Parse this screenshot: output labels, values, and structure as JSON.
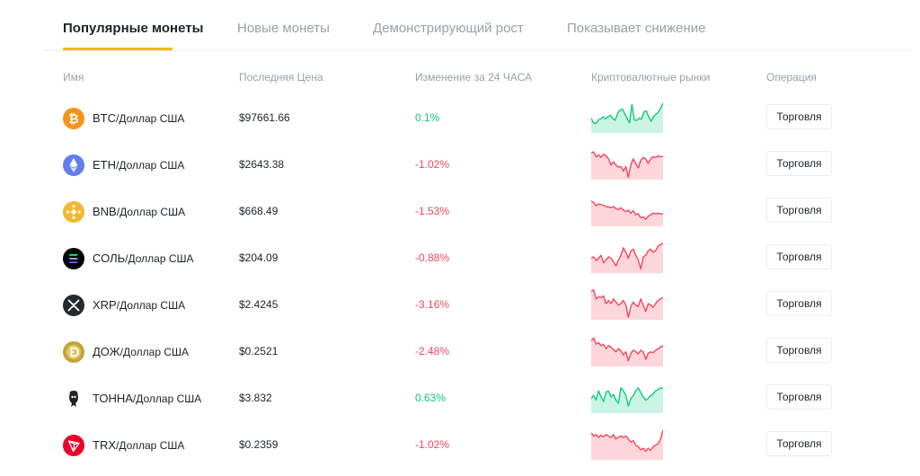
{
  "tabs": [
    {
      "label": "Популярные монеты",
      "active": true
    },
    {
      "label": "Новые монеты",
      "active": false
    },
    {
      "label": "Демонстрирующий рост",
      "active": false
    },
    {
      "label": "Показывает снижение",
      "active": false
    }
  ],
  "columns": {
    "name": "Имя",
    "price": "Последняя Цена",
    "change": "Изменение за 24 ЧАСА",
    "markets": "Криптовалютные рынки",
    "operation": "Операция"
  },
  "colors": {
    "accent": "#f0b90b",
    "up": "#0ecb81",
    "down": "#f6465d"
  },
  "coins": [
    {
      "base": "BTC",
      "quote": "/Доллар США",
      "price": "$97661.66",
      "change": "0.1%",
      "direction": "up",
      "icon": "bitcoin-icon",
      "trade": "Торговля",
      "spark": [
        0.55,
        0.7,
        0.72,
        0.6,
        0.58,
        0.5,
        0.57,
        0.5,
        0.45,
        0.55,
        0.62,
        0.4,
        0.28,
        0.25,
        0.4,
        0.55,
        0.7,
        0.1,
        0.6,
        0.62,
        0.55,
        0.58,
        0.35,
        0.3,
        0.5,
        0.65,
        0.5,
        0.42,
        0.35,
        0.22,
        0.05
      ]
    },
    {
      "base": "ETH",
      "quote": "/Доллар США",
      "price": "$2643.38",
      "change": "-1.02%",
      "direction": "down",
      "icon": "ethereum-icon",
      "trade": "Торговля",
      "spark": [
        0.15,
        0.12,
        0.28,
        0.22,
        0.3,
        0.2,
        0.25,
        0.35,
        0.55,
        0.45,
        0.55,
        0.62,
        0.6,
        0.75,
        0.6,
        0.95,
        0.55,
        0.35,
        0.5,
        0.65,
        0.4,
        0.3,
        0.35,
        0.5,
        0.35,
        0.28,
        0.3,
        0.25,
        0.28,
        0.27
      ]
    },
    {
      "base": "BNB",
      "quote": "/Доллар США",
      "price": "$668.49",
      "change": "-1.53%",
      "direction": "down",
      "icon": "bnb-icon",
      "trade": "Торговля",
      "spark": [
        0.2,
        0.25,
        0.35,
        0.3,
        0.32,
        0.35,
        0.38,
        0.4,
        0.42,
        0.38,
        0.45,
        0.48,
        0.42,
        0.5,
        0.55,
        0.5,
        0.6,
        0.52,
        0.65,
        0.62,
        0.75,
        0.72,
        0.8,
        0.7,
        0.65,
        0.6,
        0.62,
        0.6,
        0.62,
        0.62
      ]
    },
    {
      "base": "СОЛЬ",
      "quote": "/Доллар США",
      "price": "$204.09",
      "change": "-0.88%",
      "direction": "down",
      "icon": "solana-icon",
      "trade": "Торговля",
      "spark": [
        0.55,
        0.5,
        0.62,
        0.55,
        0.45,
        0.7,
        0.6,
        0.5,
        0.55,
        0.65,
        0.8,
        0.6,
        0.45,
        0.2,
        0.35,
        0.55,
        0.3,
        0.25,
        0.45,
        0.6,
        0.9,
        0.5,
        0.45,
        0.3,
        0.25,
        0.35,
        0.3,
        0.15,
        0.1,
        0.05
      ]
    },
    {
      "base": "XRP",
      "quote": "/Доллар США",
      "price": "$2.4245",
      "change": "-3.16%",
      "direction": "down",
      "icon": "xrp-icon",
      "trade": "Торговля",
      "spark": [
        0.1,
        0.05,
        0.35,
        0.28,
        0.3,
        0.25,
        0.5,
        0.4,
        0.5,
        0.35,
        0.45,
        0.55,
        0.5,
        0.4,
        0.55,
        0.95,
        0.6,
        0.45,
        0.55,
        0.6,
        0.35,
        0.55,
        0.75,
        0.5,
        0.55,
        0.62,
        0.5,
        0.4,
        0.35,
        0.3
      ]
    },
    {
      "base": "ДОЖ",
      "quote": "/Доллар США",
      "price": "$0.2521",
      "change": "-2.48%",
      "direction": "down",
      "icon": "dogecoin-icon",
      "trade": "Торговля",
      "spark": [
        0.2,
        0.1,
        0.3,
        0.25,
        0.35,
        0.3,
        0.45,
        0.35,
        0.4,
        0.48,
        0.55,
        0.45,
        0.52,
        0.65,
        0.55,
        0.85,
        0.6,
        0.5,
        0.55,
        0.62,
        0.5,
        0.55,
        0.8,
        0.6,
        0.55,
        0.58,
        0.5,
        0.45,
        0.4,
        0.35
      ]
    },
    {
      "base": "ТОННА",
      "quote": "/Доллар США",
      "price": "$3.832",
      "change": "0.63%",
      "direction": "up",
      "icon": "toncoin-icon",
      "trade": "Торговля",
      "spark": [
        0.55,
        0.45,
        0.6,
        0.3,
        0.5,
        0.65,
        0.35,
        0.3,
        0.5,
        0.42,
        0.6,
        0.7,
        0.2,
        0.3,
        0.45,
        0.8,
        0.55,
        0.45,
        0.3,
        0.2,
        0.35,
        0.5,
        0.6,
        0.55,
        0.45,
        0.4,
        0.3,
        0.25,
        0.2,
        0.22
      ]
    },
    {
      "base": "TRX",
      "quote": "/Доллар США",
      "price": "$0.2359",
      "change": "-1.02%",
      "direction": "down",
      "icon": "tron-icon",
      "trade": "Торговля",
      "spark": [
        0.15,
        0.25,
        0.2,
        0.3,
        0.22,
        0.28,
        0.2,
        0.25,
        0.3,
        0.2,
        0.35,
        0.28,
        0.25,
        0.3,
        0.25,
        0.35,
        0.45,
        0.4,
        0.55,
        0.6,
        0.7,
        0.65,
        0.75,
        0.65,
        0.72,
        0.6,
        0.55,
        0.5,
        0.35,
        0.05
      ]
    }
  ]
}
